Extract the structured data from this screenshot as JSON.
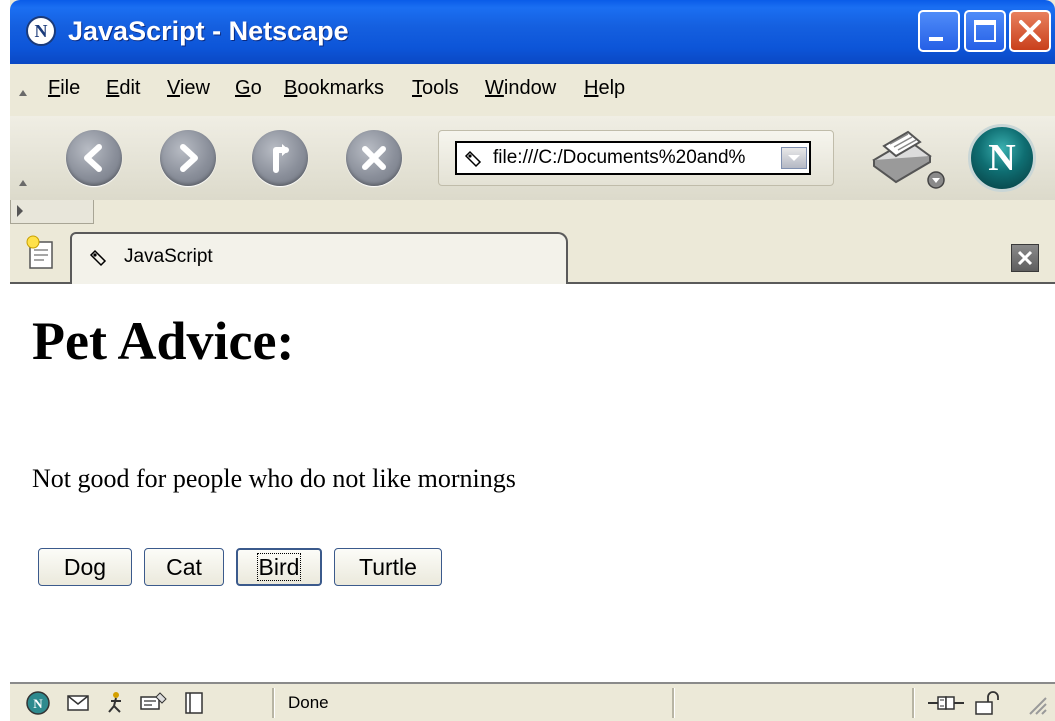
{
  "window": {
    "title": "JavaScript - Netscape",
    "app_icon_glyph": "N",
    "colors": {
      "titlebar": "#1560e0",
      "close": "#c9401c",
      "chrome": "#ece9d8"
    }
  },
  "menu": {
    "items": [
      {
        "mnemonic": "F",
        "rest": "ile"
      },
      {
        "mnemonic": "E",
        "rest": "dit"
      },
      {
        "mnemonic": "V",
        "rest": "iew"
      },
      {
        "mnemonic": "G",
        "rest": "o"
      },
      {
        "mnemonic": "B",
        "rest": "ookmarks"
      },
      {
        "mnemonic": "T",
        "rest": "ools"
      },
      {
        "mnemonic": "W",
        "rest": "indow"
      },
      {
        "mnemonic": "H",
        "rest": "elp"
      }
    ]
  },
  "toolbar": {
    "buttons": [
      "back-icon",
      "forward-icon",
      "reload-icon",
      "stop-icon"
    ],
    "url": "file:///C:/Documents%20and%",
    "logo_glyph": "N"
  },
  "tabs": {
    "active_label": "JavaScript"
  },
  "page": {
    "heading": "Pet Advice:",
    "advice": "Not good for people who do not like mornings",
    "buttons": {
      "dog": "Dog",
      "cat": "Cat",
      "bird": "Bird",
      "turtle": "Turtle"
    },
    "focused_button": "Bird"
  },
  "status": {
    "text": "Done",
    "icons": [
      "navigator-icon",
      "mail-icon",
      "aim-icon",
      "composer-icon",
      "address-book-icon",
      "connection-icon",
      "lock-icon"
    ]
  }
}
